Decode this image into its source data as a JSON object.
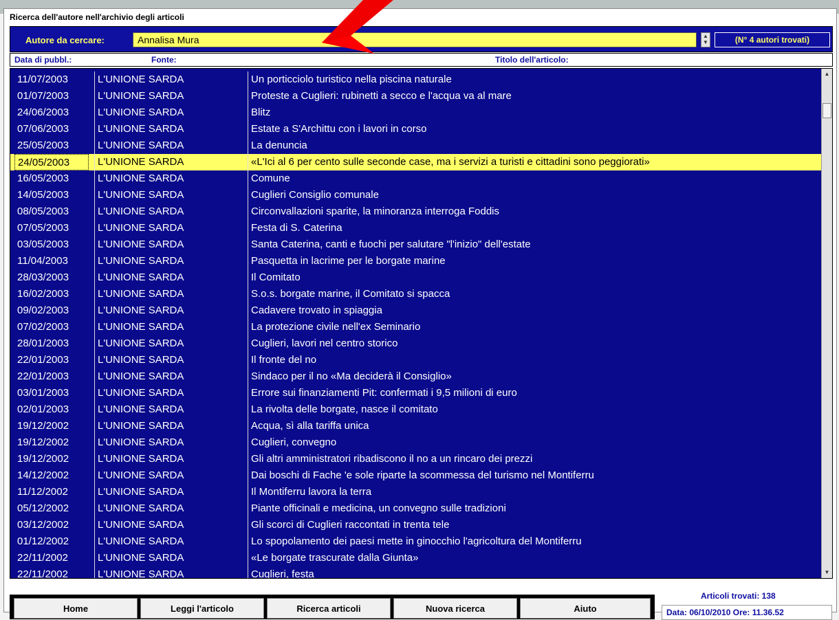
{
  "window": {
    "title": "Ricerca dell'autore nell'archivio degli articoli"
  },
  "search": {
    "label": "Autore da cercare:",
    "value": "Annalisa Mura",
    "found": "(N° 4 autori trovati)"
  },
  "columns": {
    "date": "Data di pubbl.:",
    "source": "Fonte:",
    "title": "Titolo dell'articolo:"
  },
  "selected_index": 5,
  "rows": [
    {
      "date": "11/07/2003",
      "source": "L'UNIONE SARDA",
      "title": "Un porticciolo turistico nella piscina naturale"
    },
    {
      "date": "01/07/2003",
      "source": "L'UNIONE SARDA",
      "title": "Proteste a Cuglieri: rubinetti a secco e l'acqua va al mare"
    },
    {
      "date": "24/06/2003",
      "source": "L'UNIONE SARDA",
      "title": "Blitz"
    },
    {
      "date": "07/06/2003",
      "source": "L'UNIONE SARDA",
      "title": "Estate a S'Archittu con i lavori in corso"
    },
    {
      "date": "25/05/2003",
      "source": "L'UNIONE SARDA",
      "title": "La denuncia"
    },
    {
      "date": "24/05/2003",
      "source": "L'UNIONE SARDA",
      "title": "«L'Ici al 6 per cento sulle seconde case, ma i servizi a turisti e cittadini sono peggiorati»"
    },
    {
      "date": "16/05/2003",
      "source": "L'UNIONE SARDA",
      "title": "Comune"
    },
    {
      "date": "14/05/2003",
      "source": "L'UNIONE SARDA",
      "title": "Cuglieri Consiglio comunale"
    },
    {
      "date": "08/05/2003",
      "source": "L'UNIONE SARDA",
      "title": "Circonvallazioni sparite, la minoranza interroga Foddis"
    },
    {
      "date": "07/05/2003",
      "source": "L'UNIONE SARDA",
      "title": "Festa di S. Caterina"
    },
    {
      "date": "03/05/2003",
      "source": "L'UNIONE SARDA",
      "title": "Santa Caterina, canti e fuochi per salutare \"l'inizio\" dell'estate"
    },
    {
      "date": "11/04/2003",
      "source": "L'UNIONE SARDA",
      "title": "Pasquetta in lacrime per le borgate marine"
    },
    {
      "date": "28/03/2003",
      "source": "L'UNIONE SARDA",
      "title": "Il Comitato"
    },
    {
      "date": "16/02/2003",
      "source": "L'UNIONE SARDA",
      "title": "S.o.s. borgate marine, il Comitato si spacca"
    },
    {
      "date": "09/02/2003",
      "source": "L'UNIONE SARDA",
      "title": "Cadavere trovato in spiaggia"
    },
    {
      "date": "07/02/2003",
      "source": "L'UNIONE SARDA",
      "title": "La protezione civile nell'ex Seminario"
    },
    {
      "date": "28/01/2003",
      "source": "L'UNIONE SARDA",
      "title": "Cuglieri, lavori nel centro storico"
    },
    {
      "date": "22/01/2003",
      "source": "L'UNIONE SARDA",
      "title": "Il fronte del no"
    },
    {
      "date": "22/01/2003",
      "source": "L'UNIONE SARDA",
      "title": "Sindaco per il no «Ma deciderà il Consiglio»"
    },
    {
      "date": "03/01/2003",
      "source": "L'UNIONE SARDA",
      "title": "Errore sui finanziamenti Pit: confermati i 9,5 milioni di euro"
    },
    {
      "date": "02/01/2003",
      "source": "L'UNIONE SARDA",
      "title": "La rivolta delle borgate, nasce il comitato"
    },
    {
      "date": "19/12/2002",
      "source": "L'UNIONE SARDA",
      "title": "Acqua, sì alla tariffa unica"
    },
    {
      "date": "19/12/2002",
      "source": "L'UNIONE SARDA",
      "title": "Cuglieri, convegno"
    },
    {
      "date": "19/12/2002",
      "source": "L'UNIONE SARDA",
      "title": "Gli altri amministratori ribadiscono il no a un rincaro dei prezzi"
    },
    {
      "date": "14/12/2002",
      "source": "L'UNIONE SARDA",
      "title": "Dai boschi di Fache 'e sole riparte la scommessa del turismo nel Montiferru"
    },
    {
      "date": "11/12/2002",
      "source": "L'UNIONE SARDA",
      "title": "Il Montiferru lavora la terra"
    },
    {
      "date": "05/12/2002",
      "source": "L'UNIONE SARDA",
      "title": "Piante officinali e medicina, un convegno sulle tradizioni"
    },
    {
      "date": "03/12/2002",
      "source": "L'UNIONE SARDA",
      "title": "Gli scorci di Cuglieri raccontati in trenta tele"
    },
    {
      "date": "01/12/2002",
      "source": "L'UNIONE SARDA",
      "title": "Lo spopolamento dei paesi mette in ginocchio l'agricoltura del Montiferru"
    },
    {
      "date": "22/11/2002",
      "source": "L'UNIONE SARDA",
      "title": "«Le borgate trascurate dalla Giunta»"
    },
    {
      "date": "22/11/2002",
      "source": "L'UNIONE SARDA",
      "title": "Cuglieri, festa"
    }
  ],
  "buttons": {
    "home": "Home",
    "read": "Leggi l'articolo",
    "search": "Ricerca articoli",
    "new": "Nuova ricerca",
    "help": "Aiuto"
  },
  "status": {
    "count": "Articoli trovati: 138",
    "datetime": "Data: 06/10/2010   Ore: 11.36.52"
  },
  "colors": {
    "list_bg": "#0a0a8c",
    "highlight": "#ffff66",
    "arrow": "#ff0000"
  },
  "icons": {
    "pointer": "red-arrow-icon"
  }
}
